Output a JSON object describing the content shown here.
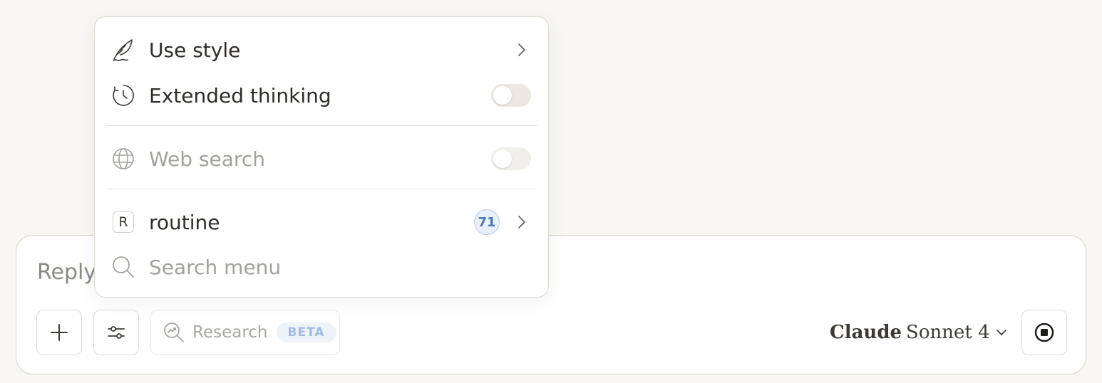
{
  "composer": {
    "placeholder": "Reply",
    "research_label": "Research",
    "research_badge": "BETA",
    "model_brand": "Claude",
    "model_name": "Sonnet 4"
  },
  "menu": {
    "items": [
      {
        "label": "Use style",
        "icon": "quill-icon",
        "control": "chevron"
      },
      {
        "label": "Extended thinking",
        "icon": "clock-icon",
        "control": "toggle",
        "enabled": false
      },
      {
        "label": "Web search",
        "icon": "globe-icon",
        "control": "toggle",
        "enabled": false,
        "disabled": true
      },
      {
        "label": "routine",
        "icon": "R",
        "control": "chevron",
        "badge": "71"
      },
      {
        "label": "Search menu",
        "icon": "search-icon",
        "control": "search-input"
      }
    ]
  },
  "colors": {
    "background": "#f8f7f4",
    "accent_blue": "#4c78b8",
    "muted_text": "#a3a19b"
  }
}
